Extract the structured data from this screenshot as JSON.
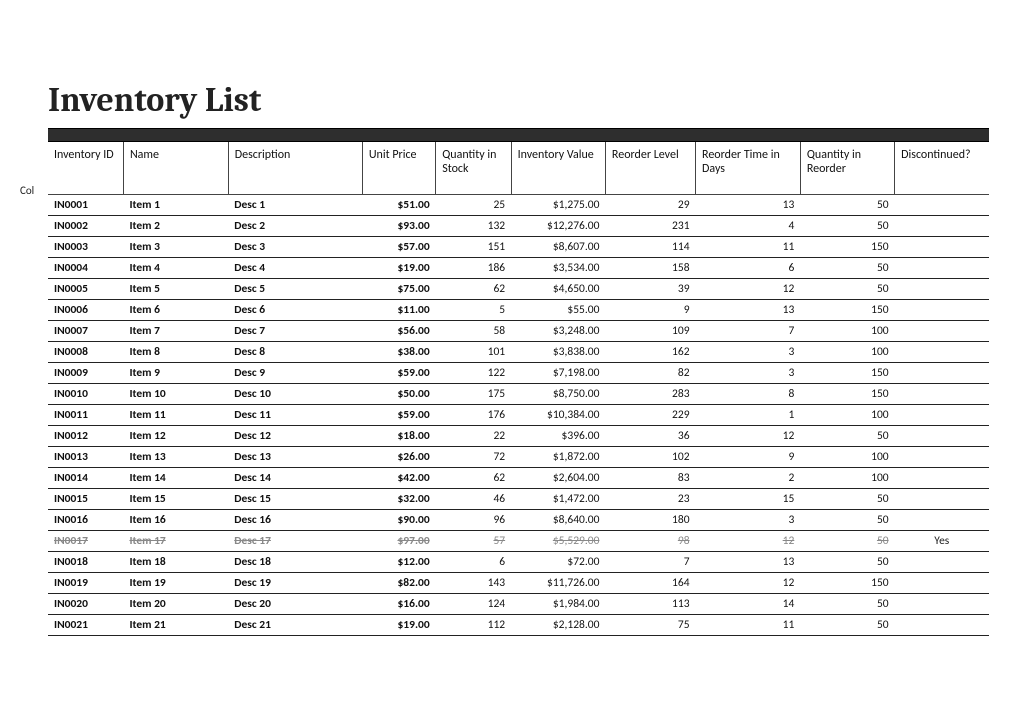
{
  "title": "Inventory List",
  "side_label": "Col",
  "columns": [
    "Inventory ID",
    "Name",
    "Description",
    "Unit Price",
    "Quantity in Stock",
    "Inventory Value",
    "Reorder Level",
    "Reorder Time in Days",
    "Quantity in Reorder",
    "Discontinued?"
  ],
  "rows": [
    {
      "id": "IN0001",
      "name": "Item 1",
      "desc": "Desc 1",
      "price": "$51.00",
      "qty": "25",
      "value": "$1,275.00",
      "reorder": "29",
      "days": "13",
      "qre": "50",
      "disc": ""
    },
    {
      "id": "IN0002",
      "name": "Item 2",
      "desc": "Desc 2",
      "price": "$93.00",
      "qty": "132",
      "value": "$12,276.00",
      "reorder": "231",
      "days": "4",
      "qre": "50",
      "disc": ""
    },
    {
      "id": "IN0003",
      "name": "Item 3",
      "desc": "Desc 3",
      "price": "$57.00",
      "qty": "151",
      "value": "$8,607.00",
      "reorder": "114",
      "days": "11",
      "qre": "150",
      "disc": ""
    },
    {
      "id": "IN0004",
      "name": "Item 4",
      "desc": "Desc 4",
      "price": "$19.00",
      "qty": "186",
      "value": "$3,534.00",
      "reorder": "158",
      "days": "6",
      "qre": "50",
      "disc": ""
    },
    {
      "id": "IN0005",
      "name": "Item 5",
      "desc": "Desc 5",
      "price": "$75.00",
      "qty": "62",
      "value": "$4,650.00",
      "reorder": "39",
      "days": "12",
      "qre": "50",
      "disc": ""
    },
    {
      "id": "IN0006",
      "name": "Item 6",
      "desc": "Desc 6",
      "price": "$11.00",
      "qty": "5",
      "value": "$55.00",
      "reorder": "9",
      "days": "13",
      "qre": "150",
      "disc": ""
    },
    {
      "id": "IN0007",
      "name": "Item 7",
      "desc": "Desc 7",
      "price": "$56.00",
      "qty": "58",
      "value": "$3,248.00",
      "reorder": "109",
      "days": "7",
      "qre": "100",
      "disc": ""
    },
    {
      "id": "IN0008",
      "name": "Item 8",
      "desc": "Desc 8",
      "price": "$38.00",
      "qty": "101",
      "value": "$3,838.00",
      "reorder": "162",
      "days": "3",
      "qre": "100",
      "disc": ""
    },
    {
      "id": "IN0009",
      "name": "Item 9",
      "desc": "Desc 9",
      "price": "$59.00",
      "qty": "122",
      "value": "$7,198.00",
      "reorder": "82",
      "days": "3",
      "qre": "150",
      "disc": ""
    },
    {
      "id": "IN0010",
      "name": "Item 10",
      "desc": "Desc 10",
      "price": "$50.00",
      "qty": "175",
      "value": "$8,750.00",
      "reorder": "283",
      "days": "8",
      "qre": "150",
      "disc": ""
    },
    {
      "id": "IN0011",
      "name": "Item 11",
      "desc": "Desc 11",
      "price": "$59.00",
      "qty": "176",
      "value": "$10,384.00",
      "reorder": "229",
      "days": "1",
      "qre": "100",
      "disc": ""
    },
    {
      "id": "IN0012",
      "name": "Item 12",
      "desc": "Desc 12",
      "price": "$18.00",
      "qty": "22",
      "value": "$396.00",
      "reorder": "36",
      "days": "12",
      "qre": "50",
      "disc": ""
    },
    {
      "id": "IN0013",
      "name": "Item 13",
      "desc": "Desc 13",
      "price": "$26.00",
      "qty": "72",
      "value": "$1,872.00",
      "reorder": "102",
      "days": "9",
      "qre": "100",
      "disc": ""
    },
    {
      "id": "IN0014",
      "name": "Item 14",
      "desc": "Desc 14",
      "price": "$42.00",
      "qty": "62",
      "value": "$2,604.00",
      "reorder": "83",
      "days": "2",
      "qre": "100",
      "disc": ""
    },
    {
      "id": "IN0015",
      "name": "Item 15",
      "desc": "Desc 15",
      "price": "$32.00",
      "qty": "46",
      "value": "$1,472.00",
      "reorder": "23",
      "days": "15",
      "qre": "50",
      "disc": ""
    },
    {
      "id": "IN0016",
      "name": "Item 16",
      "desc": "Desc 16",
      "price": "$90.00",
      "qty": "96",
      "value": "$8,640.00",
      "reorder": "180",
      "days": "3",
      "qre": "50",
      "disc": ""
    },
    {
      "id": "IN0017",
      "name": "Item 17",
      "desc": "Desc 17",
      "price": "$97.00",
      "qty": "57",
      "value": "$5,529.00",
      "reorder": "98",
      "days": "12",
      "qre": "50",
      "disc": "Yes",
      "discontinued": true
    },
    {
      "id": "IN0018",
      "name": "Item 18",
      "desc": "Desc 18",
      "price": "$12.00",
      "qty": "6",
      "value": "$72.00",
      "reorder": "7",
      "days": "13",
      "qre": "50",
      "disc": ""
    },
    {
      "id": "IN0019",
      "name": "Item 19",
      "desc": "Desc 19",
      "price": "$82.00",
      "qty": "143",
      "value": "$11,726.00",
      "reorder": "164",
      "days": "12",
      "qre": "150",
      "disc": ""
    },
    {
      "id": "IN0020",
      "name": "Item 20",
      "desc": "Desc 20",
      "price": "$16.00",
      "qty": "124",
      "value": "$1,984.00",
      "reorder": "113",
      "days": "14",
      "qre": "50",
      "disc": ""
    },
    {
      "id": "IN0021",
      "name": "Item 21",
      "desc": "Desc 21",
      "price": "$19.00",
      "qty": "112",
      "value": "$2,128.00",
      "reorder": "75",
      "days": "11",
      "qre": "50",
      "disc": ""
    }
  ]
}
